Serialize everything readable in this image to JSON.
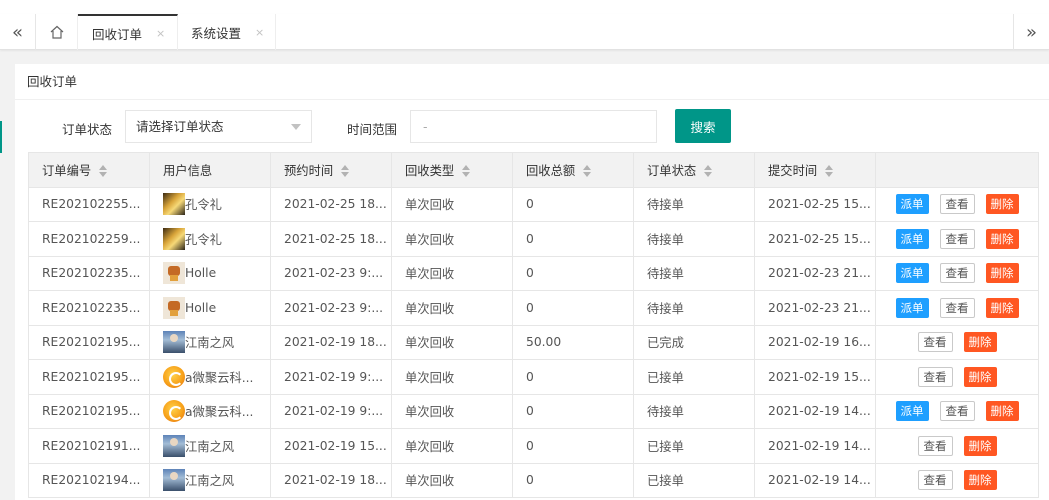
{
  "tabs": {
    "prev_icon": "«",
    "next_icon": "»",
    "items": [
      {
        "label": "回收订单",
        "close": "×"
      },
      {
        "label": "系统设置",
        "close": "×"
      }
    ]
  },
  "panel": {
    "title": "回收订单"
  },
  "filters": {
    "status_label": "订单状态",
    "status_placeholder": "请选择订单状态",
    "time_label": "时间范围",
    "time_value": "-",
    "search_label": "搜索"
  },
  "table": {
    "headers": [
      "订单编号",
      "用户信息",
      "预约时间",
      "回收类型",
      "回收总额",
      "订单状态",
      "提交时间",
      ""
    ],
    "actions": {
      "dispatch": "派单",
      "view": "查看",
      "delete": "删除"
    },
    "rows": [
      {
        "id": "RE202102255...",
        "avatar": "a",
        "user": "孔令礼",
        "appt": "2021-02-25 18...",
        "type": "单次回收",
        "total": "0",
        "status": "待接单",
        "submit": "2021-02-25 15..."
      },
      {
        "id": "RE202102259...",
        "avatar": "a",
        "user": "孔令礼",
        "appt": "2021-02-25 18...",
        "type": "单次回收",
        "total": "0",
        "status": "待接单",
        "submit": "2021-02-25 15..."
      },
      {
        "id": "RE202102235...",
        "avatar": "b",
        "user": "Holle",
        "appt": "2021-02-23 9:...",
        "type": "单次回收",
        "total": "0",
        "status": "待接单",
        "submit": "2021-02-23 21..."
      },
      {
        "id": "RE202102235...",
        "avatar": "b",
        "user": "Holle",
        "appt": "2021-02-23 9:...",
        "type": "单次回收",
        "total": "0",
        "status": "待接单",
        "submit": "2021-02-23 21..."
      },
      {
        "id": "RE202102195...",
        "avatar": "c",
        "user": "江南之风",
        "appt": "2021-02-19 18...",
        "type": "单次回收",
        "total": "50.00",
        "status": "已完成",
        "submit": "2021-02-19 16..."
      },
      {
        "id": "RE202102195...",
        "avatar": "d",
        "user": "a微聚云科...",
        "appt": "2021-02-19 9:...",
        "type": "单次回收",
        "total": "0",
        "status": "已接单",
        "submit": "2021-02-19 15..."
      },
      {
        "id": "RE202102195...",
        "avatar": "d",
        "user": "a微聚云科...",
        "appt": "2021-02-19 9:...",
        "type": "单次回收",
        "total": "0",
        "status": "待接单",
        "submit": "2021-02-19 14..."
      },
      {
        "id": "RE202102191...",
        "avatar": "c",
        "user": "江南之风",
        "appt": "2021-02-19 15...",
        "type": "单次回收",
        "total": "0",
        "status": "已接单",
        "submit": "2021-02-19 14..."
      },
      {
        "id": "RE202102194...",
        "avatar": "c",
        "user": "江南之风",
        "appt": "2021-02-19 18...",
        "type": "单次回收",
        "total": "0",
        "status": "已接单",
        "submit": "2021-02-19 14..."
      }
    ]
  },
  "colors": {
    "primary": "#009688",
    "dispatch": "#1e9fff",
    "delete": "#ff5722"
  }
}
